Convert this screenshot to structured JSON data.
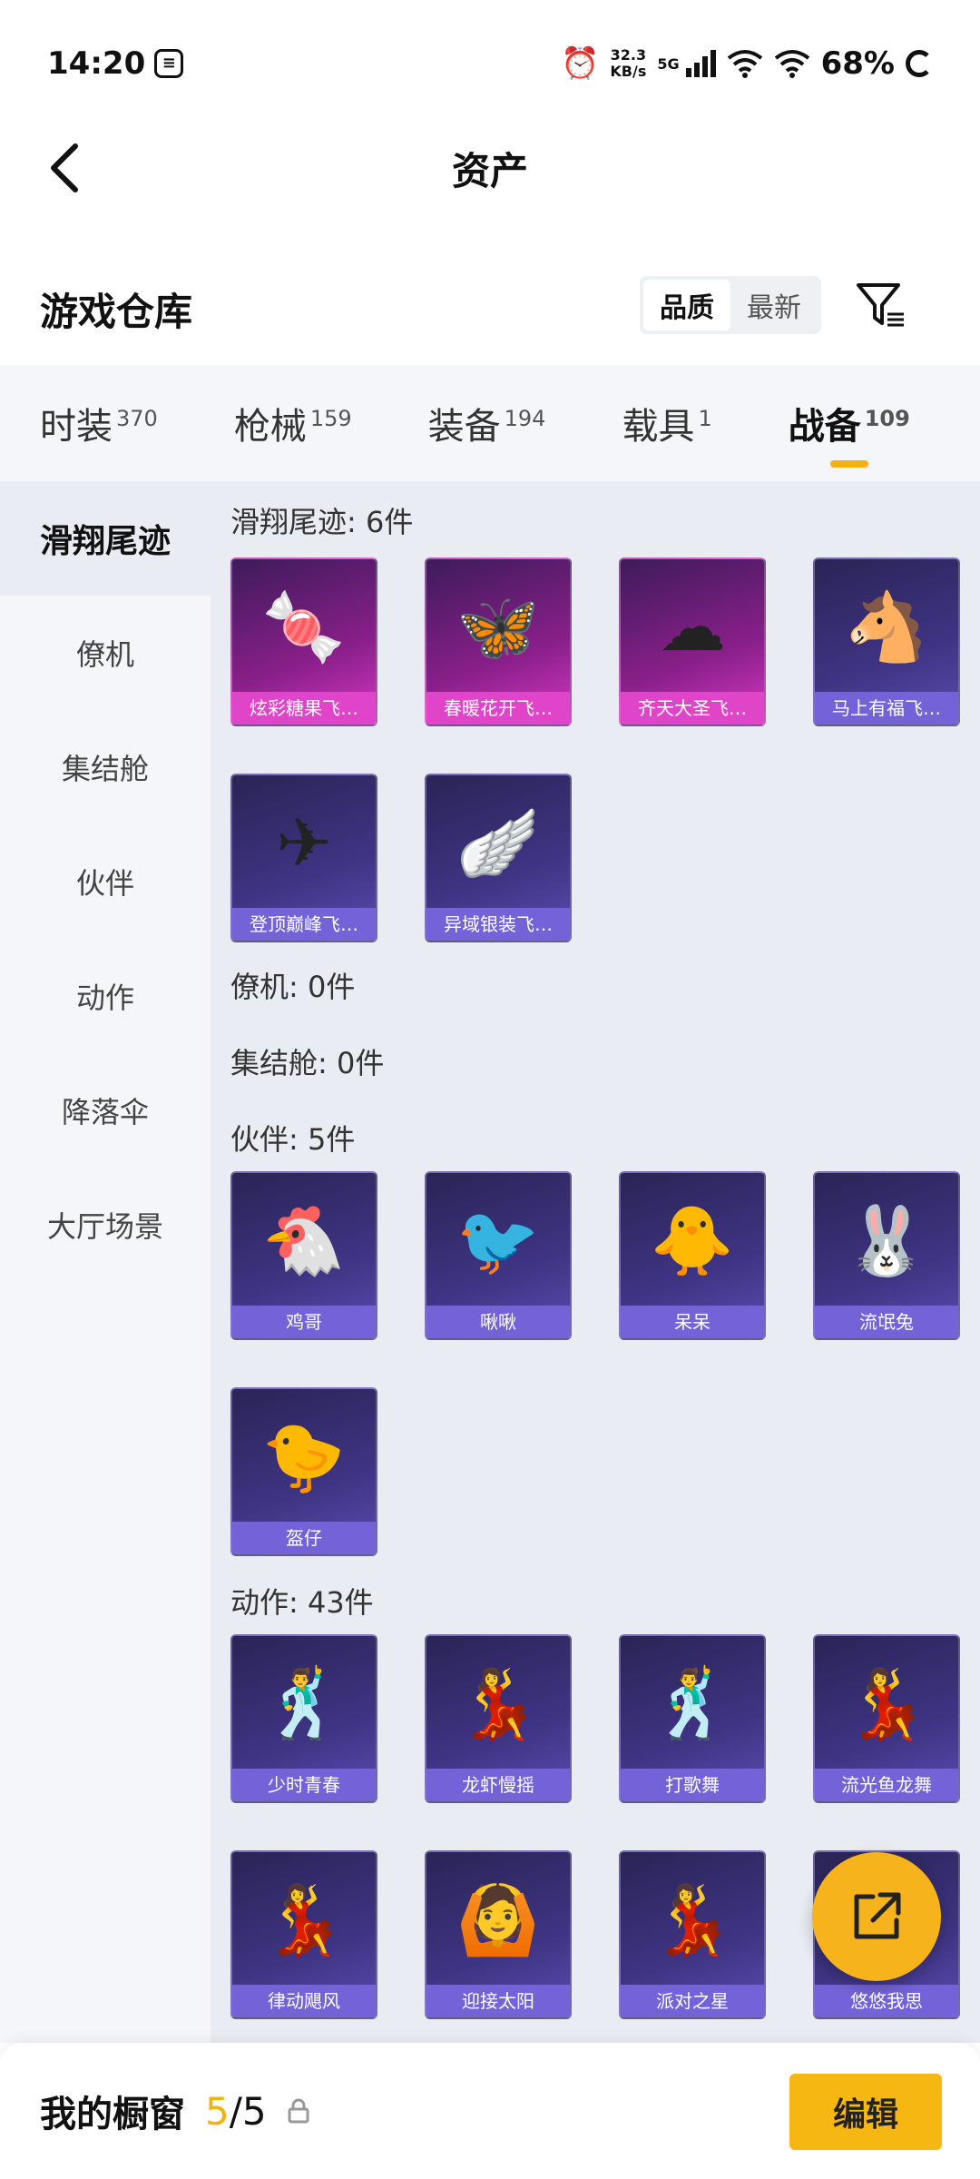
{
  "status_bar": {
    "time": "14:20",
    "net_speed_value": "32.3",
    "net_speed_unit": "KB/s",
    "signal_label": "5G",
    "battery": "68%"
  },
  "header": {
    "title": "资产"
  },
  "warehouse": {
    "title": "游戏仓库",
    "sort_options": [
      "品质",
      "最新"
    ],
    "active_sort": "品质"
  },
  "tabs": [
    {
      "label": "时装",
      "count": "370"
    },
    {
      "label": "枪械",
      "count": "159"
    },
    {
      "label": "装备",
      "count": "194"
    },
    {
      "label": "载具",
      "count": "1"
    },
    {
      "label": "战备",
      "count": "109"
    }
  ],
  "active_tab": "战备",
  "sidebar": {
    "items": [
      "滑翔尾迹",
      "僚机",
      "集结舱",
      "伙伴",
      "动作",
      "降落伞",
      "大厅场景"
    ],
    "active": "滑翔尾迹"
  },
  "sections": [
    {
      "title": "滑翔尾迹: 6件",
      "items": [
        {
          "label": "炫彩糖果飞…",
          "icon": "candy-icon",
          "rarity": "pink"
        },
        {
          "label": "春暖花开飞…",
          "icon": "butterfly-icon",
          "rarity": "pink"
        },
        {
          "label": "齐天大圣飞…",
          "icon": "cloud-icon",
          "rarity": "pink"
        },
        {
          "label": "马上有福飞…",
          "icon": "horse-icon",
          "rarity": "purple"
        },
        {
          "label": "登顶巅峰飞…",
          "icon": "glider-icon",
          "rarity": "purple"
        },
        {
          "label": "异域银装飞…",
          "icon": "wing-icon",
          "rarity": "purple"
        }
      ]
    },
    {
      "title": "僚机: 0件",
      "items": []
    },
    {
      "title": "集结舱: 0件",
      "items": []
    },
    {
      "title": "伙伴: 5件",
      "items": [
        {
          "label": "鸡哥",
          "icon": "chicken-icon",
          "rarity": "purple"
        },
        {
          "label": "啾啾",
          "icon": "pink-bird-icon",
          "rarity": "purple"
        },
        {
          "label": "呆呆",
          "icon": "chick-icon",
          "rarity": "purple"
        },
        {
          "label": "流氓兔",
          "icon": "rabbit-icon",
          "rarity": "purple"
        },
        {
          "label": "盔仔",
          "icon": "helmet-chick-icon",
          "rarity": "purple"
        }
      ]
    },
    {
      "title": "动作: 43件",
      "items": [
        {
          "label": "少时青春",
          "icon": "dance-icon",
          "rarity": "purple"
        },
        {
          "label": "龙虾慢摇",
          "icon": "dance-icon",
          "rarity": "purple"
        },
        {
          "label": "打歌舞",
          "icon": "dance-icon",
          "rarity": "purple"
        },
        {
          "label": "流光鱼龙舞",
          "icon": "dance-icon",
          "rarity": "purple"
        },
        {
          "label": "律动飓风",
          "icon": "dance-icon",
          "rarity": "purple"
        },
        {
          "label": "迎接太阳",
          "icon": "dance-icon",
          "rarity": "purple"
        },
        {
          "label": "派对之星",
          "icon": "dance-icon",
          "rarity": "purple"
        },
        {
          "label": "悠悠我思",
          "icon": "dance-icon",
          "rarity": "purple"
        }
      ]
    }
  ],
  "bottom_bar": {
    "label": "我的橱窗",
    "count_current": "5",
    "count_separator": "/",
    "count_total": "5",
    "edit_label": "编辑"
  },
  "colors": {
    "accent": "#f2b312",
    "card_purple": "#7462d8",
    "card_pink": "#e045c9"
  }
}
